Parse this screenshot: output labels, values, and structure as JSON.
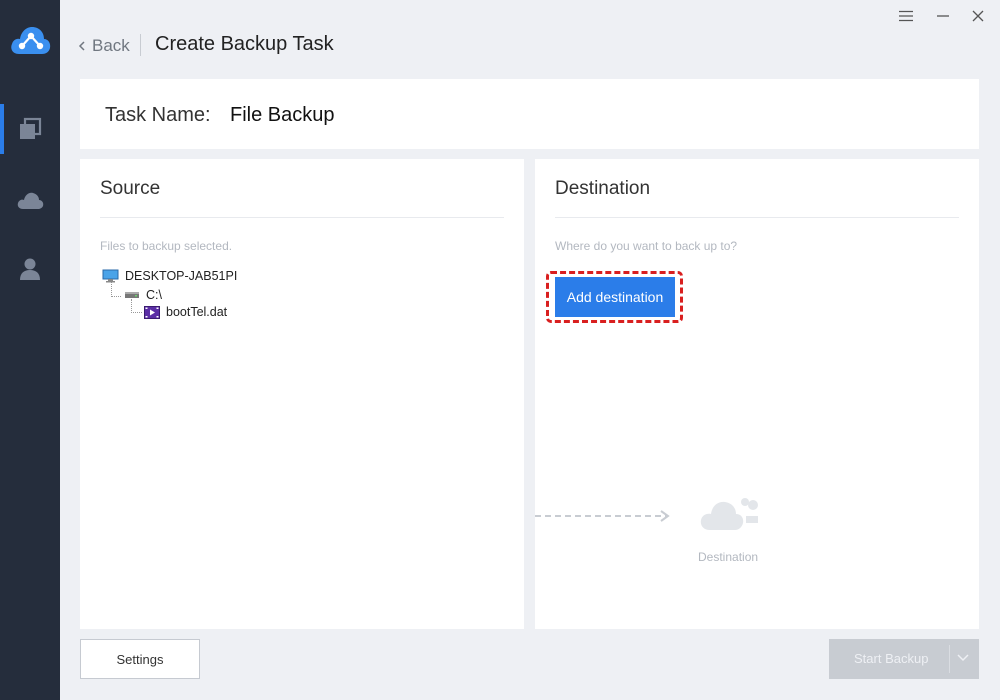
{
  "app": {
    "page_title": "Create Backup Task",
    "back_label": "Back",
    "accent_color": "#2b7de9",
    "sidebar_bg": "#252d3c"
  },
  "sidebar": {
    "items": [
      {
        "name": "backup",
        "icon": "backup-copy-icon",
        "active": true
      },
      {
        "name": "cloud",
        "icon": "cloud-icon",
        "active": false
      },
      {
        "name": "account",
        "icon": "user-icon",
        "active": false
      }
    ]
  },
  "window_controls": [
    "menu-icon",
    "minimize-icon",
    "close-icon"
  ],
  "task": {
    "label": "Task Name:",
    "value": "File Backup"
  },
  "source": {
    "title": "Source",
    "hint": "Files to backup selected.",
    "tree": {
      "computer": "DESKTOP-JAB51PI",
      "drive": "C:\\",
      "file": "bootTel.dat"
    }
  },
  "destination": {
    "title": "Destination",
    "hint": "Where do you want to back up to?",
    "add_button": "Add destination",
    "illustration_caption": "Destination",
    "highlight_color": "#d91f1f"
  },
  "footer": {
    "settings_label": "Settings",
    "start_label": "Start Backup",
    "start_enabled": false
  }
}
